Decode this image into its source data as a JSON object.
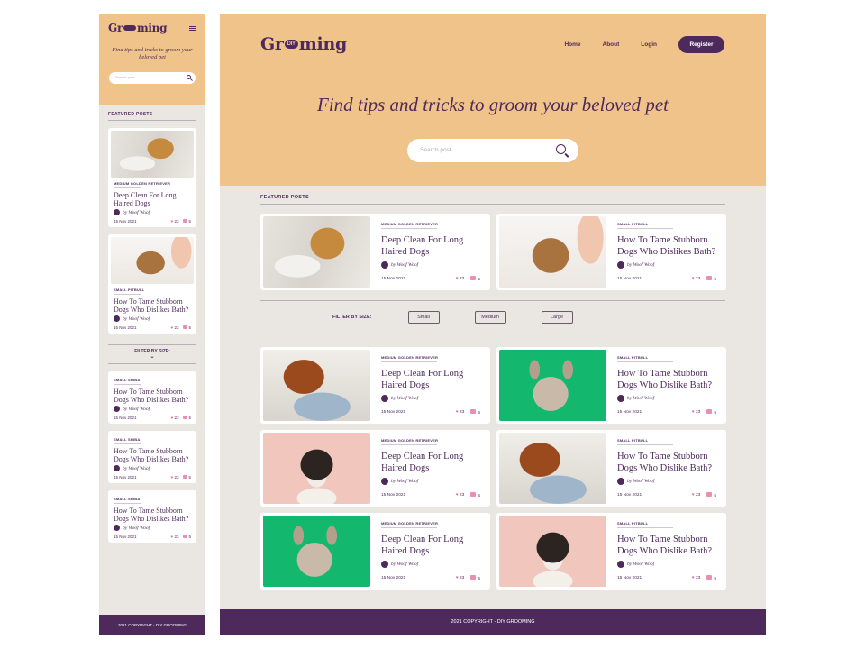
{
  "brand": {
    "name_pre": "Gr",
    "name_pill": "DIY",
    "name_post": "ming"
  },
  "nav": {
    "home": "Home",
    "about": "About",
    "login": "Login",
    "register": "Register"
  },
  "hero": {
    "tagline": "Find tips and tricks to groom your beloved pet",
    "search_placeholder": "Search post"
  },
  "mobile": {
    "tagline": "Find tips and tricks to groom your beloved pet",
    "search_placeholder": "Search post",
    "featured_title": "FEATURED POSTS",
    "featured": [
      {
        "tag": "MEDIUM GOLDEN RETRIEVER",
        "title": "Deep Clean For Long Haired Dogs",
        "author": "by Woof Woof",
        "date": "15 Nov 2021",
        "likes": "23",
        "comments": "5"
      },
      {
        "tag": "SMALL PITBULL",
        "title": "How To Tame Stubborn Dogs Who Dislikes Bath?",
        "author": "by Woof Woof",
        "date": "15 Nov 2021",
        "likes": "23",
        "comments": "5"
      }
    ],
    "filter_label": "FILTER BY SIZE:",
    "posts": [
      {
        "tag": "SMALL SHIBA",
        "title": "How To Tame Stubborn Dogs Who Dislikes Bath?",
        "author": "by Woof Woof",
        "date": "15 Nov 2021",
        "likes": "23",
        "comments": "5"
      },
      {
        "tag": "SMALL SHIBA",
        "title": "How To Tame Stubborn Dogs Who Dislikes Bath?",
        "author": "by Woof Woof",
        "date": "15 Nov 2021",
        "likes": "23",
        "comments": "5"
      },
      {
        "tag": "SMALL SHIBA",
        "title": "How To Tame Stubborn Dogs Who Dislikes Bath?",
        "author": "by Woof Woof",
        "date": "15 Nov 2021",
        "likes": "23",
        "comments": "5"
      }
    ],
    "footer": "2021 COPYRIGHT - DIY GROOMING"
  },
  "desktop": {
    "featured_title": "FEATURED POSTS",
    "featured": [
      {
        "tag": "MEDIUM GOLDEN RETRIEVER",
        "title": "Deep Clean For Long Haired Dogs",
        "author": "by Woof Woof",
        "date": "15 Nov 2021",
        "likes": "23",
        "comments": "5"
      },
      {
        "tag": "SMALL PITBULL",
        "title": "How To Tame Stubborn Dogs Who Dislikes Bath?",
        "author": "by Woof Woof",
        "date": "15 Nov 2021",
        "likes": "23",
        "comments": "5"
      }
    ],
    "filter": {
      "label": "FILTER BY SIZE:",
      "small": "Small",
      "medium": "Medium",
      "large": "Large"
    },
    "posts": [
      {
        "tag": "MEDIUM GOLDEN RETRIEVER",
        "title": "Deep Clean For Long Haired Dogs",
        "author": "by Woof Woof",
        "date": "15 Nov 2021",
        "likes": "23",
        "comments": "5"
      },
      {
        "tag": "SMALL PITBULL",
        "title": "How To Tame Stubborn Dogs Who Dislike Bath?",
        "author": "by Woof Woof",
        "date": "15 Nov 2021",
        "likes": "23",
        "comments": "5"
      },
      {
        "tag": "MEDIUM GOLDEN RETRIEVER",
        "title": "Deep Clean For Long Haired Dogs",
        "author": "by Woof Woof",
        "date": "15 Nov 2021",
        "likes": "23",
        "comments": "5"
      },
      {
        "tag": "SMALL PITBULL",
        "title": "How To Tame Stubborn Dogs Who Dislike Bath?",
        "author": "by Woof Woof",
        "date": "15 Nov 2021",
        "likes": "23",
        "comments": "5"
      },
      {
        "tag": "MEDIUM GOLDEN RETRIEVER",
        "title": "Deep Clean For Long Haired Dogs",
        "author": "by Woof Woof",
        "date": "15 Nov 2021",
        "likes": "23",
        "comments": "5"
      },
      {
        "tag": "SMALL PITBULL",
        "title": "How To Tame Stubborn Dogs Who Dislike Bath?",
        "author": "by Woof Woof",
        "date": "15 Nov 2021",
        "likes": "23",
        "comments": "5"
      }
    ],
    "footer": "2021 COPYRIGHT - DIY GROOMING"
  },
  "icons": {
    "like": "heart-icon",
    "comment": "comment-icon",
    "search": "search-icon",
    "menu": "hamburger-menu-icon"
  },
  "colors": {
    "accent": "#4e2a5c",
    "hero_bg": "#f0c38b",
    "page_bg": "#eae7e2",
    "like": "#d96a9a"
  }
}
